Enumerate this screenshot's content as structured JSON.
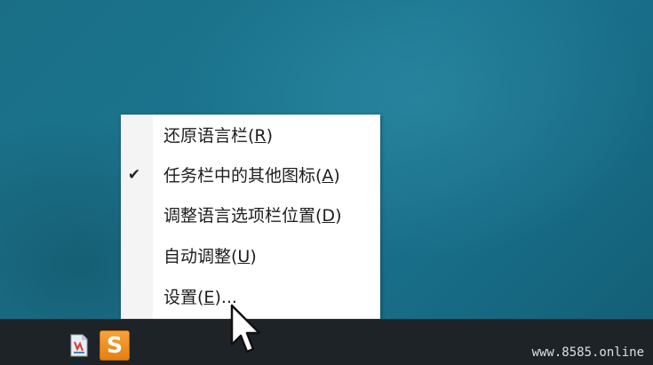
{
  "context_menu": {
    "items": [
      {
        "text": "还原语言栏(",
        "key": "R",
        "suffix": ")",
        "checked": false
      },
      {
        "text": "任务栏中的其他图标(",
        "key": "A",
        "suffix": ")",
        "checked": true
      },
      {
        "text": "调整语言选项栏位置(",
        "key": "D",
        "suffix": ")",
        "checked": false
      },
      {
        "text": "自动调整(",
        "key": "U",
        "suffix": ")",
        "checked": false
      },
      {
        "text": "设置(",
        "key": "E",
        "suffix": ")...",
        "checked": false
      }
    ],
    "check_glyph": "✔"
  },
  "taskbar": {
    "tray_icons": [
      "language-bar-icon",
      "sogou-input-icon"
    ],
    "sogou_letter": "S"
  },
  "watermark": "www.8585.online",
  "colors": {
    "desktop": "#1b7590",
    "taskbar": "#1d2326",
    "menu_bg": "#ffffff",
    "menu_gutter": "#f4f4f4",
    "sogou_orange": "#e67f12"
  }
}
